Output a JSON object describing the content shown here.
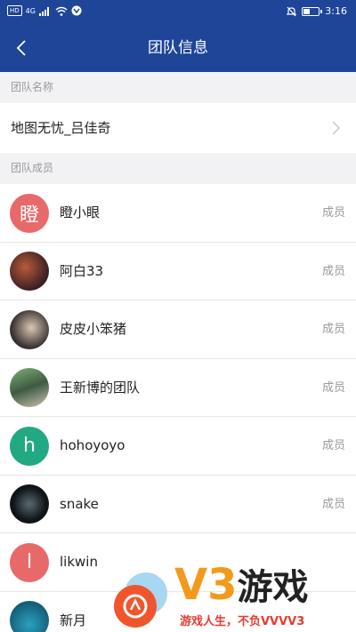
{
  "status_bar": {
    "network_label": "HD",
    "signal_label": "4G",
    "time": "3:16"
  },
  "header": {
    "title": "团队信息"
  },
  "team_section": {
    "label": "团队名称",
    "team_name": "地图无忧_吕佳奇"
  },
  "members_section": {
    "label": "团队成员"
  },
  "members": [
    {
      "name": "瞪小眼",
      "role": "成员",
      "avatar_letter": "瞪",
      "avatar_color": "#e8696a",
      "avatar_type": "letter"
    },
    {
      "name": "阿白33",
      "role": "成员",
      "avatar_type": "photo",
      "avatar_color": "#6b3a3a"
    },
    {
      "name": "皮皮小笨猪",
      "role": "成员",
      "avatar_type": "photo",
      "avatar_color": "#4a4040"
    },
    {
      "name": "王新博的团队",
      "role": "成员",
      "avatar_type": "photo",
      "avatar_color": "#5f8a5a"
    },
    {
      "name": "hohoyoyo",
      "role": "成员",
      "avatar_letter": "h",
      "avatar_color": "#22a883",
      "avatar_type": "letter"
    },
    {
      "name": "snake",
      "role": "成员",
      "avatar_type": "photo",
      "avatar_color": "#0e1418"
    },
    {
      "name": "likwin",
      "role": "",
      "avatar_letter": "l",
      "avatar_color": "#e8696a",
      "avatar_type": "letter"
    },
    {
      "name": "新月",
      "role": "",
      "avatar_type": "photo",
      "avatar_color": "#1c7fa0"
    }
  ],
  "watermark": {
    "brand_v3": "V3",
    "brand_game": "游戏",
    "slogan": "游戏人生，不负VVVV3"
  },
  "colors": {
    "header_bg": "#1e4597",
    "watermark_orange": "#f39a1c",
    "watermark_red": "#e63b2e"
  }
}
